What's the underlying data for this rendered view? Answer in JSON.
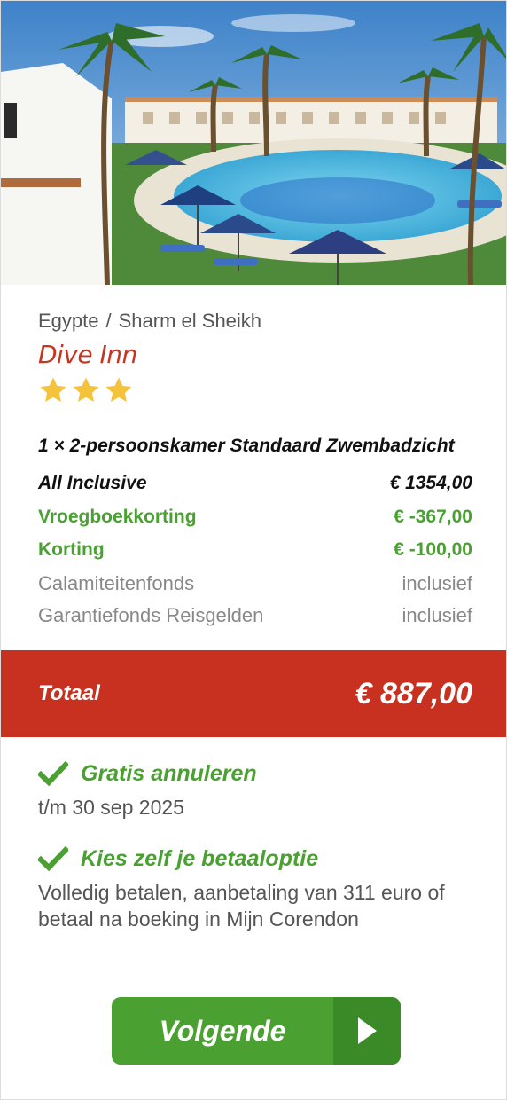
{
  "hotel": {
    "country": "Egypte",
    "separator": "/",
    "city": "Sharm el Sheikh",
    "name": "Dive Inn",
    "rating": 3,
    "hero_image": "resort-pool-with-palm-trees-and-umbrellas"
  },
  "booking": {
    "room": "1 × 2-persoonskamer Standaard Zwembadzicht",
    "base": {
      "label": "All Inclusive",
      "amount": "€ 1354,00"
    },
    "discounts": [
      {
        "label": "Vroegboekkorting",
        "amount": "€ -367,00"
      },
      {
        "label": "Korting",
        "amount": "€ -100,00"
      }
    ],
    "fees": [
      {
        "label": "Calamiteitenfonds",
        "amount": "inclusief"
      },
      {
        "label": "Garantiefonds Reisgelden",
        "amount": "inclusief"
      }
    ],
    "total": {
      "label": "Totaal",
      "amount": "€ 887,00"
    }
  },
  "perks": [
    {
      "icon": "check-icon",
      "title": "Gratis annuleren",
      "text": "t/m 30 sep 2025"
    },
    {
      "icon": "check-icon",
      "title": "Kies zelf je betaaloptie",
      "text": "Volledig betalen, aanbetaling van 311 euro of betaal na boeking in Mijn Corendon"
    }
  ],
  "actions": {
    "next_label": "Volgende"
  },
  "colors": {
    "brand_red": "#c8311f",
    "brand_green": "#4aa132",
    "green_dark": "#3a8a27",
    "star": "#f5c33b"
  }
}
